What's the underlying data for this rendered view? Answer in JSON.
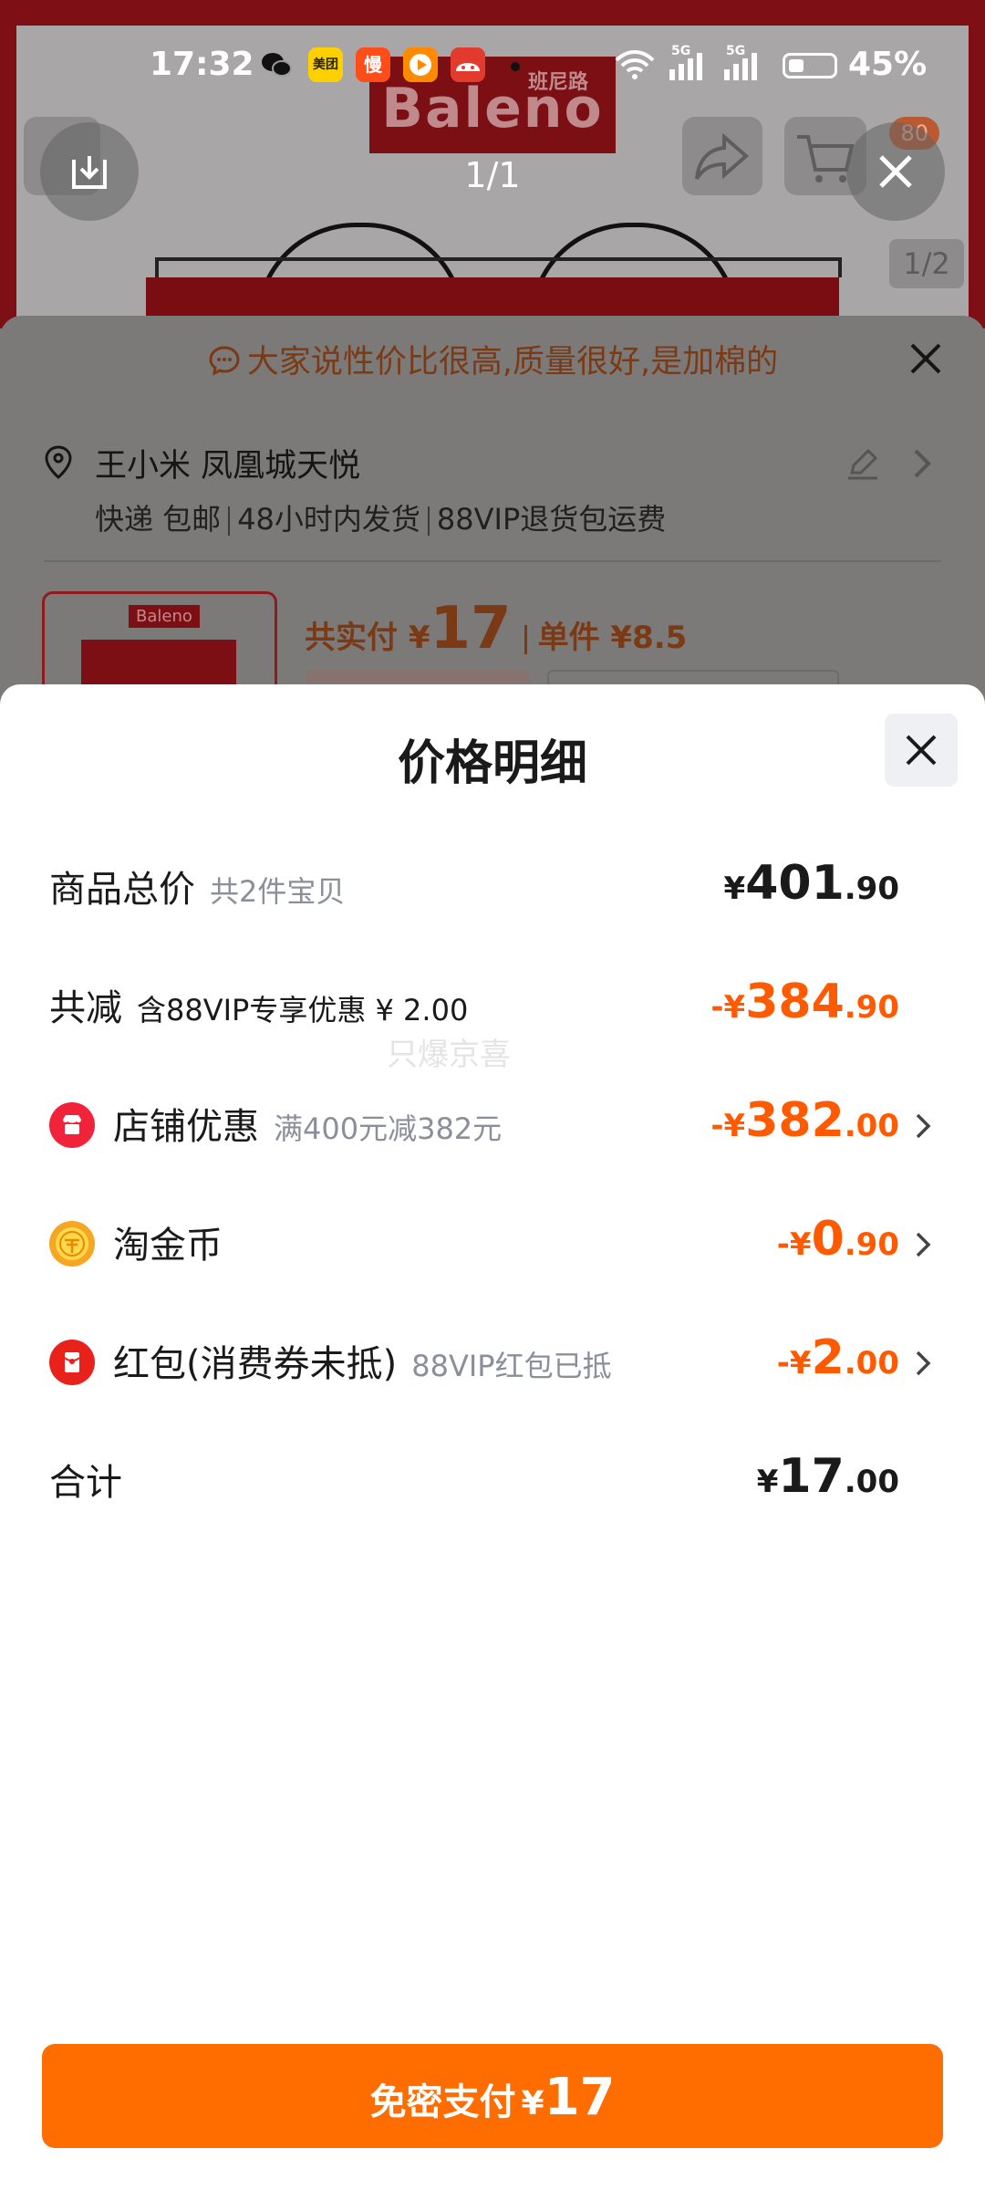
{
  "status_bar": {
    "time": "17:32",
    "battery": "45%",
    "app_icons": [
      "wechat-icon",
      "meituan-icon",
      "man-app-icon",
      "video-app-icon",
      "taobao-app-icon"
    ],
    "meituan_label": "美团",
    "man_label": "慢",
    "signal_labels": [
      "5G",
      "5G"
    ]
  },
  "image_viewer": {
    "counter": "1/1"
  },
  "background_page": {
    "brand_logo": "Baleno",
    "brand_logo_sub": "班尼路",
    "cart_badge": "80",
    "image_pager": "1/2",
    "notice": "大家说性价比很高,质量很好,是加棉的",
    "address": "王小米 凤凰城天悦",
    "shipping": [
      "快递 包邮",
      "48小时内发货",
      "88VIP退货包运费"
    ],
    "product_thumb_logo": "Baleno",
    "price_label": "共实付",
    "price_currency": "¥",
    "price_value": "17",
    "unit_price": "单件 ¥8.5"
  },
  "price_detail": {
    "title": "价格明细",
    "rows": [
      {
        "label": "商品总价",
        "sub": "共2件宝贝",
        "currency": "¥",
        "int": "401",
        "dec": ".90",
        "prefix": ""
      },
      {
        "label": "共减",
        "sub": "含88VIP专享优惠 ¥ 2.00",
        "currency": "¥",
        "int": "384",
        "dec": ".90",
        "prefix": "-"
      },
      {
        "label": "店铺优惠",
        "sub": "满400元减382元",
        "currency": "¥",
        "int": "382",
        "dec": ".00",
        "prefix": "-"
      },
      {
        "label": "淘金币",
        "sub": "",
        "currency": "¥",
        "int": "0",
        "dec": ".90",
        "prefix": "-"
      },
      {
        "label": "红包(消费券未抵)",
        "sub": "88VIP红包已抵",
        "currency": "¥",
        "int": "2",
        "dec": ".00",
        "prefix": "-"
      },
      {
        "label": "合计",
        "sub": "",
        "currency": "¥",
        "int": "17",
        "dec": ".00",
        "prefix": ""
      }
    ],
    "watermark": "只爆京喜"
  },
  "pay_button": {
    "label": "免密支付",
    "currency": "¥",
    "amount": "17"
  },
  "colors": {
    "accent": "#ff6c00",
    "discount": "#ff5a00",
    "store_icon": "#f0233a",
    "coin_icon": "#f5a623",
    "redpacket_icon": "#e8221b"
  }
}
